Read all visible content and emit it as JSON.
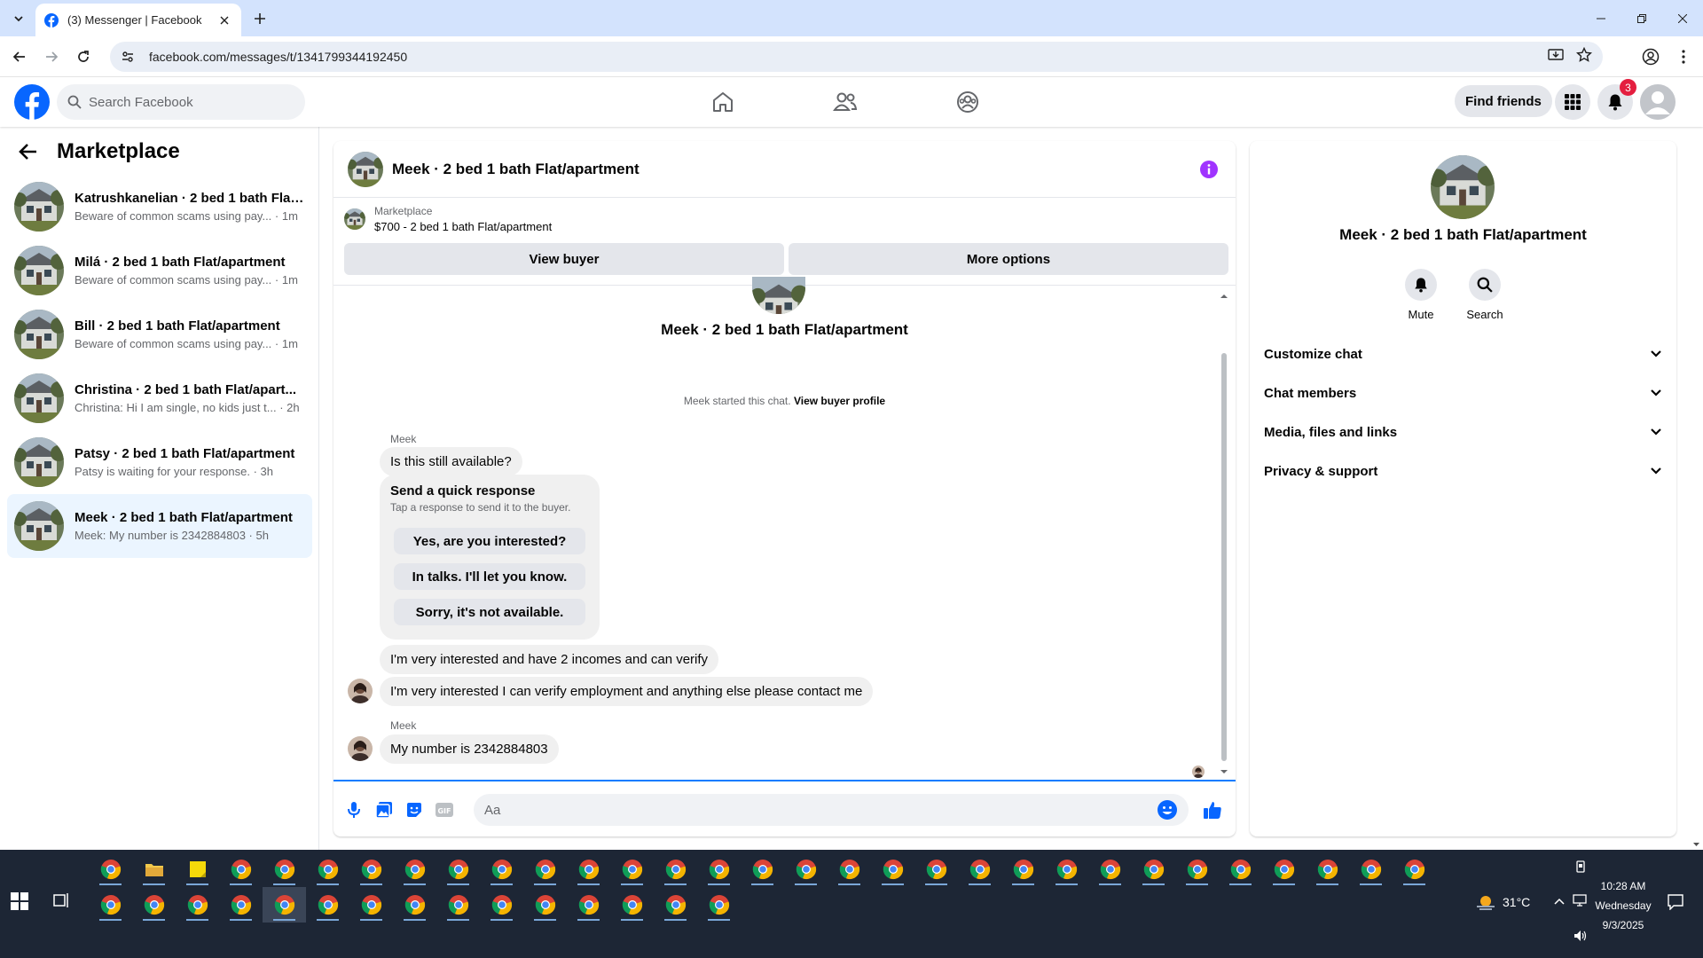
{
  "browser": {
    "tab_title": "(3) Messenger | Facebook",
    "url": "facebook.com/messages/t/1341799344192450"
  },
  "header": {
    "search_placeholder": "Search Facebook",
    "find_friends": "Find friends",
    "notification_count": "3",
    "brand_color": "#0866ff"
  },
  "sidebar": {
    "title": "Marketplace",
    "conversations": [
      {
        "name": "Katrushkanelian · 2 bed 1 bath Flat...",
        "preview": "Beware of common scams using pay... · 1m"
      },
      {
        "name": "Milá · 2 bed 1 bath Flat/apartment",
        "preview": "Beware of common scams using pay... · 1m"
      },
      {
        "name": "Bill · 2 bed 1 bath Flat/apartment",
        "preview": "Beware of common scams using pay... · 1m"
      },
      {
        "name": "Christina · 2 bed 1 bath Flat/apart...",
        "preview": "Christina: Hi I am single, no kids just t... · 2h"
      },
      {
        "name": "Patsy · 2 bed 1 bath Flat/apartment",
        "preview": "Patsy is waiting for your response. · 3h"
      },
      {
        "name": "Meek · 2 bed 1 bath Flat/apartment",
        "preview": "Meek: My number is 2342884803 · 5h"
      }
    ]
  },
  "chat": {
    "title": "Meek · 2 bed 1 bath Flat/apartment",
    "marketplace_label": "Marketplace",
    "listing": "$700 - 2 bed 1 bath Flat/apartment",
    "view_buyer": "View buyer",
    "more_options": "More options",
    "conversation_title": "Meek · 2 bed 1 bath Flat/apartment",
    "started_text": "Meek started this chat.",
    "view_buyer_profile": "View buyer profile",
    "sender_name": "Meek",
    "msg1": "Is this still available?",
    "quick_response": {
      "heading": "Send a quick response",
      "sub": "Tap a response to send it to the buyer.",
      "options": [
        "Yes, are you interested?",
        "In talks. I'll let you know.",
        "Sorry, it's not available."
      ]
    },
    "msg2": "I'm very interested and have 2 incomes and can verify",
    "msg3": "I'm very interested I can verify employment and anything else please contact me",
    "sender_name2": "Meek",
    "msg4": "My number is 2342884803",
    "composer_placeholder": "Aa"
  },
  "details": {
    "name": "Meek · 2 bed 1 bath Flat/apartment",
    "mute": "Mute",
    "search": "Search",
    "sections": [
      "Customize chat",
      "Chat members",
      "Media, files and links",
      "Privacy & support"
    ]
  },
  "taskbar": {
    "temperature": "31°C",
    "time": "10:28 AM",
    "day": "Wednesday",
    "date": "9/3/2025"
  }
}
